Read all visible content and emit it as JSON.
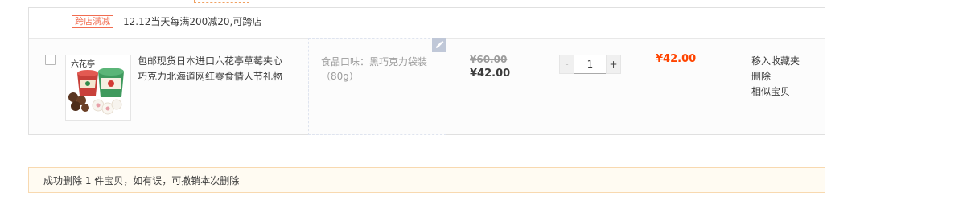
{
  "shop_promo": {
    "badge": "跨店满减",
    "text": "12.12当天每满200减20,可跨店"
  },
  "item": {
    "thumb_brand_text": "六花亭",
    "title": "包邮现货日本进口六花亭草莓夹心巧克力北海道网红零食情人节礼物",
    "sku": "食品口味：黑巧克力袋装（80g）",
    "original_price": "¥60.00",
    "current_price": "¥42.00",
    "quantity_minus": "-",
    "quantity": "1",
    "quantity_plus": "+",
    "subtotal": "¥42.00",
    "actions": {
      "move_to_favorites": "移入收藏夹",
      "delete": "删除",
      "similar": "相似宝贝"
    },
    "edit_icon": "pencil-icon"
  },
  "notice": {
    "text": "成功删除 1 件宝贝，如有误，可撤销本次删除"
  },
  "colors": {
    "price_red": "#ff4400",
    "badge_red": "#f16d51",
    "notice_bg": "#fffbf2",
    "notice_border": "#f8d9b0"
  }
}
